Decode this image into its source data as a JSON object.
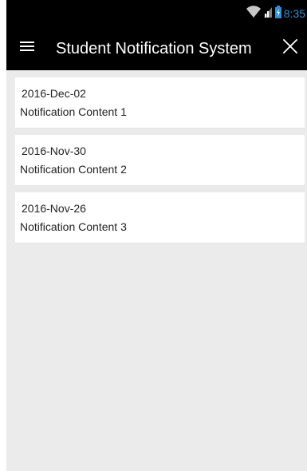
{
  "status_bar": {
    "time": "8:35",
    "icons": [
      "wifi-icon",
      "signal-icon",
      "battery-charging-icon"
    ],
    "time_color": "#2f8fd6"
  },
  "app_bar": {
    "title": "Student Notification System",
    "icons": [
      "menu-icon",
      "close-icon"
    ],
    "background": "#000000"
  },
  "notifications": [
    {
      "date": "2016-Dec-02",
      "content": "Notification Content 1"
    },
    {
      "date": "2016-Nov-30",
      "content": "Notification Content 2"
    },
    {
      "date": "2016-Nov-26",
      "content": "Notification Content 3"
    }
  ],
  "colors": {
    "list_background": "#ebebeb",
    "card_background": "#ffffff",
    "text": "#222222"
  }
}
